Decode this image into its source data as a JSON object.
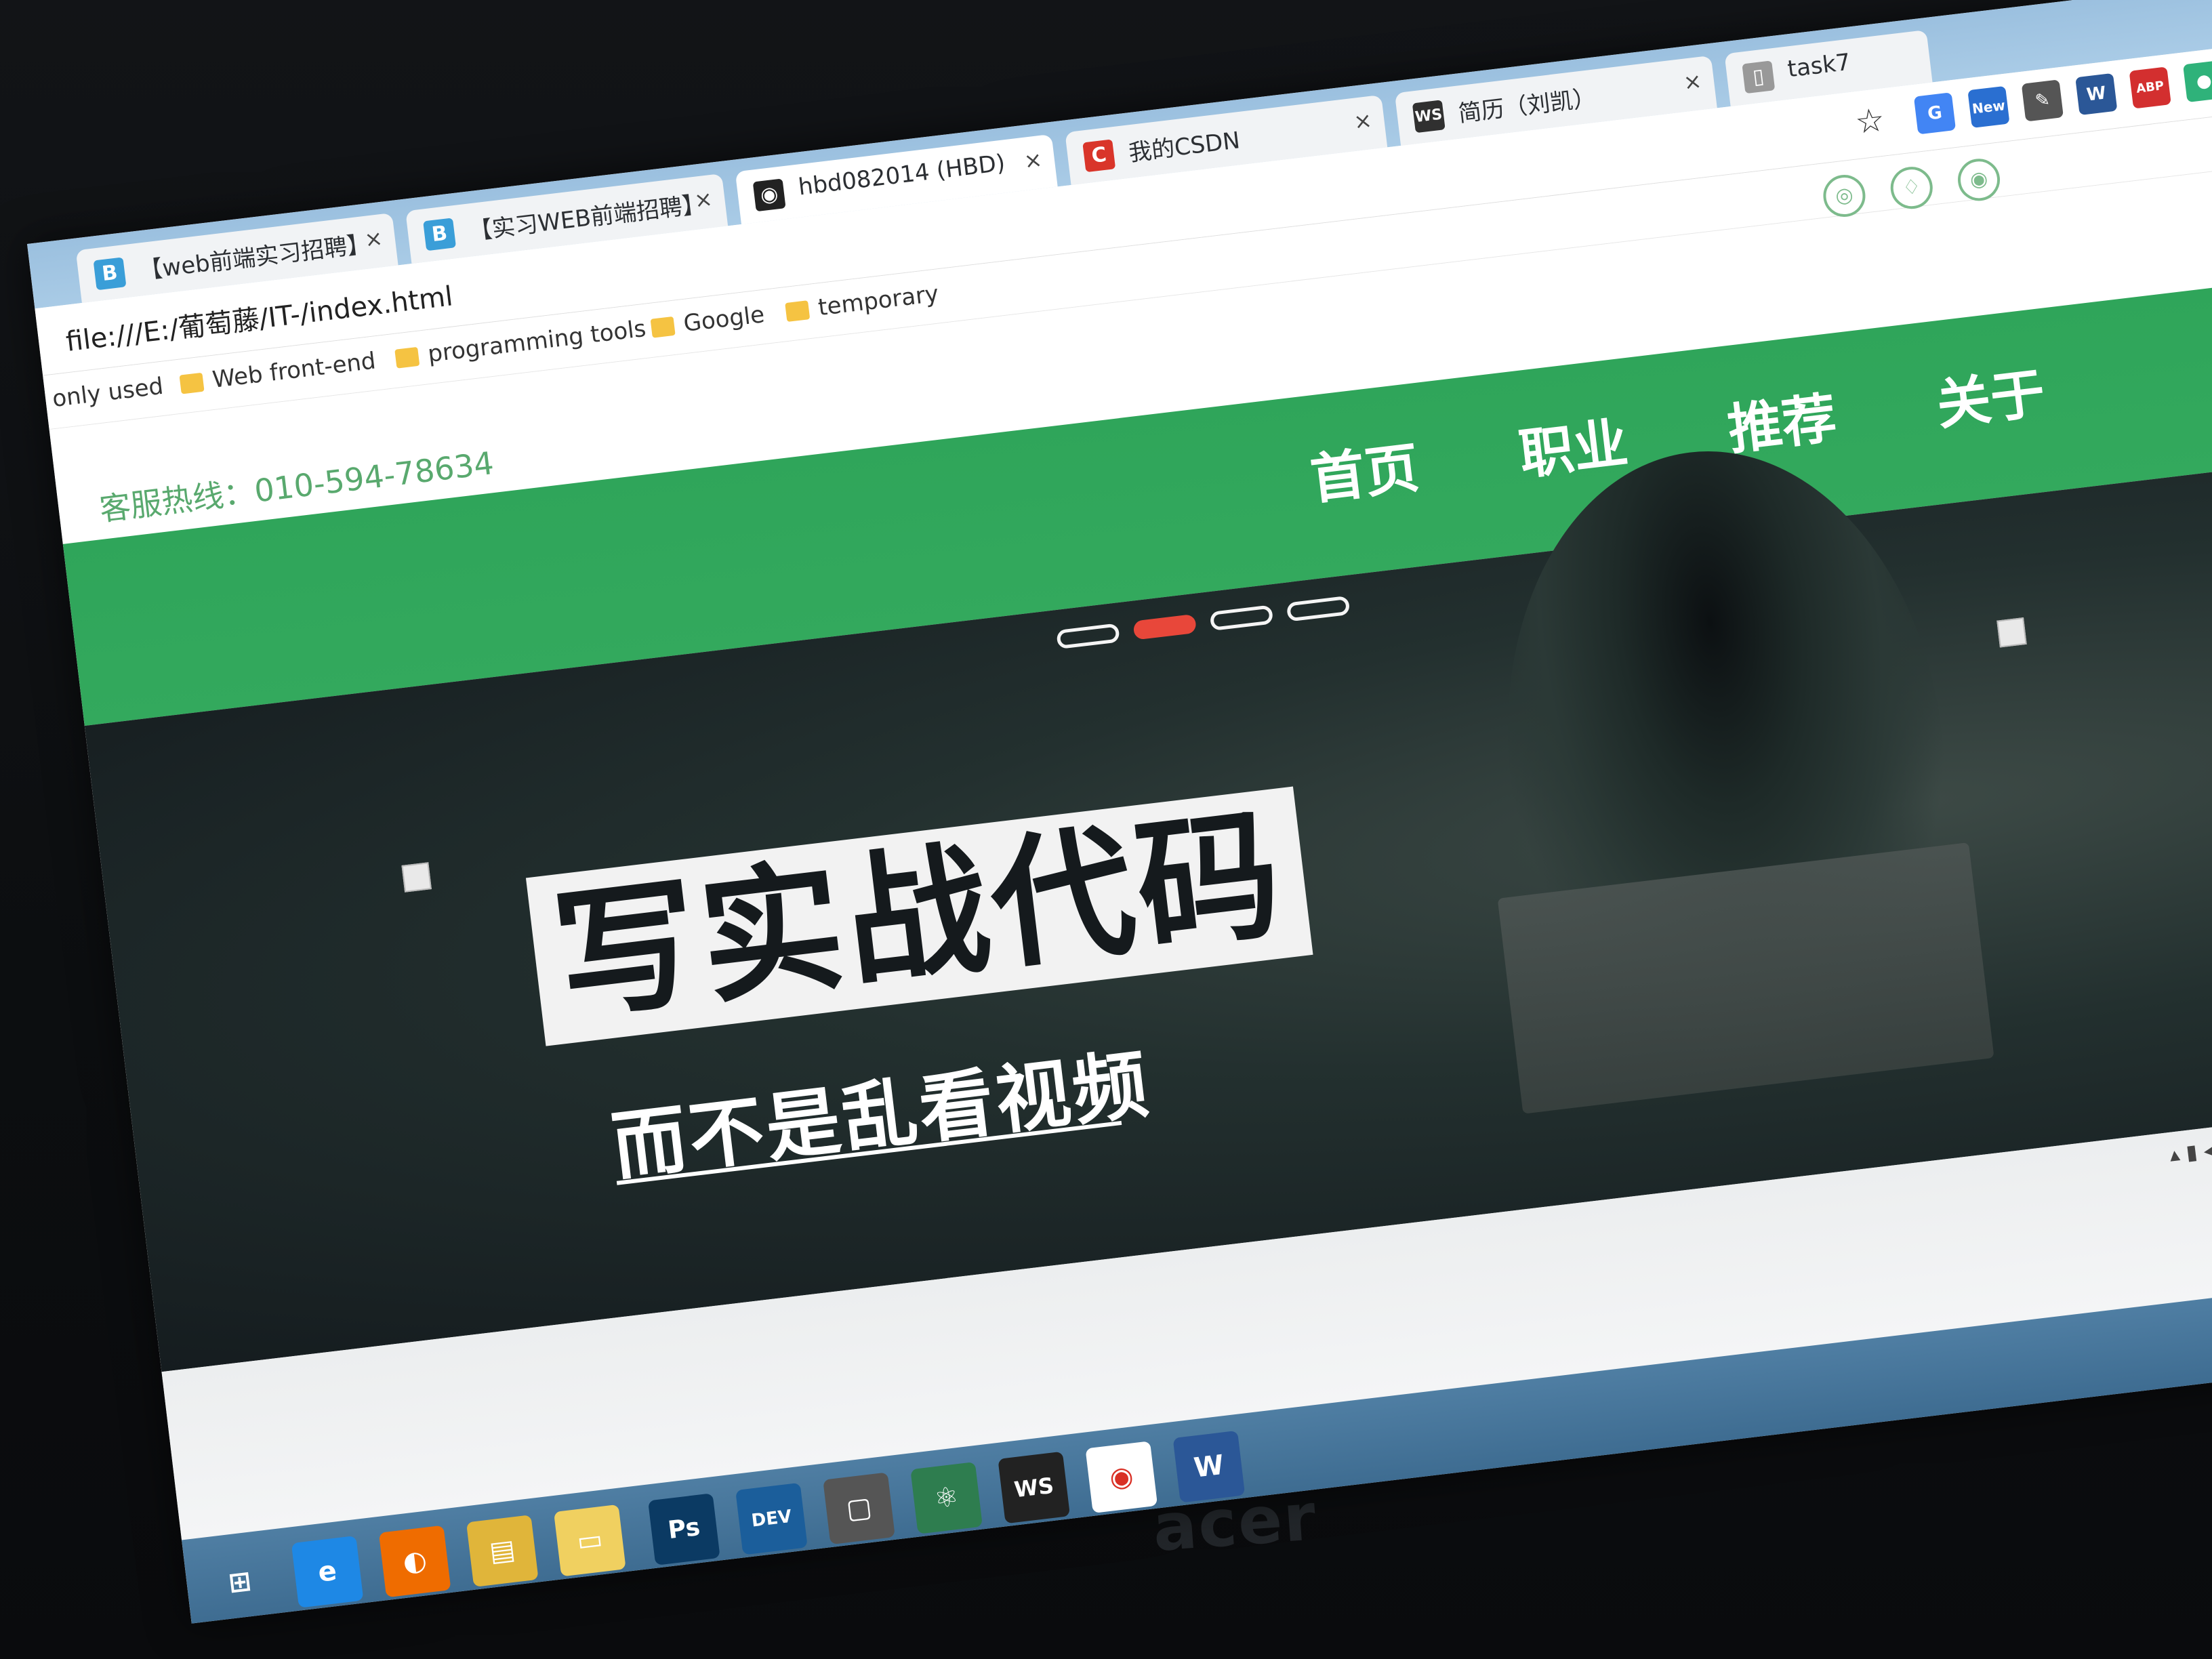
{
  "browser": {
    "tabs": [
      {
        "label": "【web前端实习招聘】",
        "icon": "B",
        "icon_color": "#3a9ed8"
      },
      {
        "label": "【实习WEB前端招聘】",
        "icon": "B",
        "icon_color": "#3a9ed8"
      },
      {
        "label": "hbd082014 (HBD)",
        "icon": "◉",
        "icon_color": "#222222"
      },
      {
        "label": "我的CSDN",
        "icon": "C",
        "icon_color": "#d9352a"
      },
      {
        "label": "简历（刘凯）",
        "icon": "WS",
        "icon_color": "#303030"
      },
      {
        "label": "task7",
        "icon": "▯",
        "icon_color": "#777777"
      }
    ],
    "tab_close_glyph": "×",
    "url": "file:///E:/葡萄藤/IT-/index.html",
    "extensions": [
      {
        "name": "translate-icon",
        "glyph": "G",
        "color": "#4285f4"
      },
      {
        "name": "new-badge-icon",
        "glyph": "New",
        "color": "#2a6fd1"
      },
      {
        "name": "eyedropper-icon",
        "glyph": "✎",
        "color": "#333333"
      },
      {
        "name": "word-icon",
        "glyph": "W",
        "color": "#2b5797"
      },
      {
        "name": "adblock-icon",
        "glyph": "ABP",
        "color": "#d32f2f"
      },
      {
        "name": "green-dot-icon",
        "glyph": "●",
        "color": "#2fb27a"
      }
    ],
    "bookmarks": [
      "only used",
      "Web front-end",
      "programming tools",
      "Google",
      "temporary"
    ]
  },
  "site": {
    "hotline": "客服热线：010-594-78634",
    "nav": [
      "首页",
      "职业",
      "推荐",
      "关于"
    ],
    "hero": {
      "headline": "写实战代码",
      "subline": "而不是乱看视频",
      "slides_total": 4,
      "active_slide": 2
    }
  },
  "laptop_brand": "acer",
  "colors": {
    "nav_green": "#33a95d",
    "hotline_green": "#59a96e",
    "active_dot": "#e8473a"
  }
}
